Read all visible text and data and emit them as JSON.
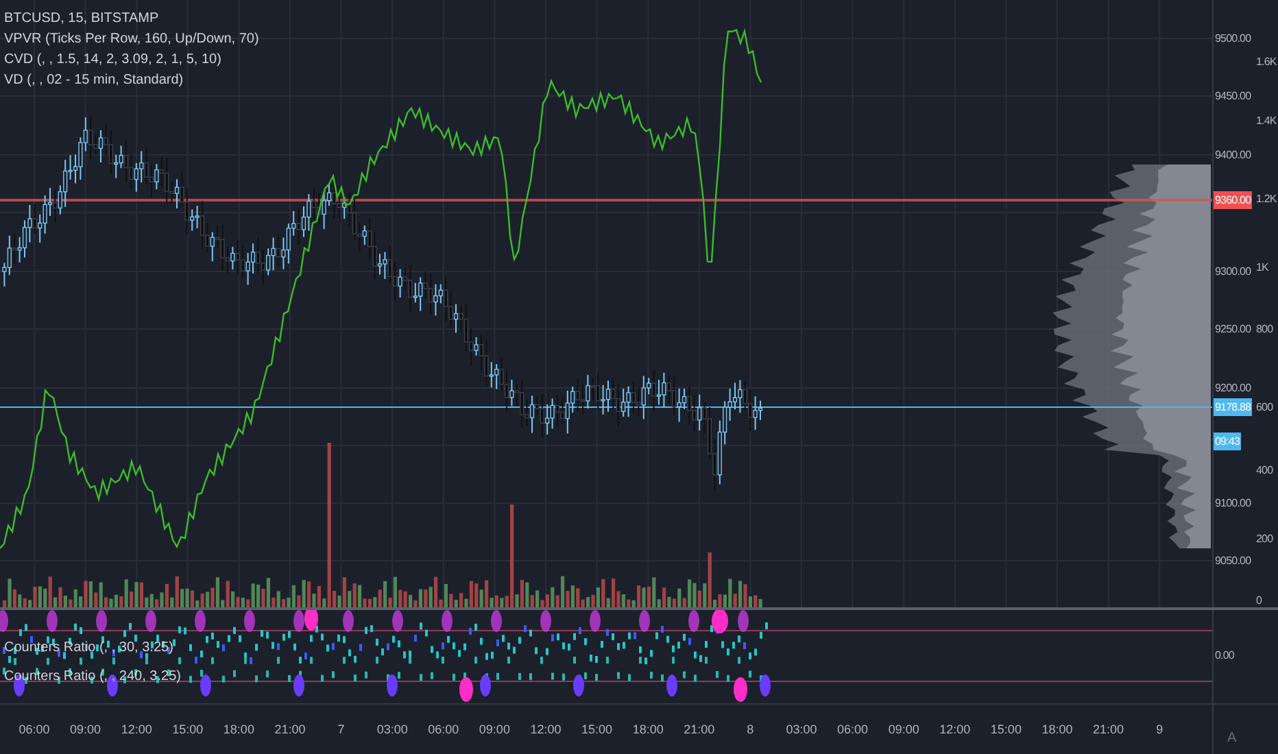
{
  "legend": [
    "BTCUSD, 15, BITSTAMP",
    "VPVR (Ticks Per Row, 160, Up/Down, 70)",
    "CVD (, , 1.5, 14, 2, 3.09, 2, 1, 5, 10)",
    "VD (, , 02 - 15 min, Standard)"
  ],
  "price_axis": [
    {
      "kind": "tick",
      "text": "9500.00"
    },
    {
      "kind": "tick",
      "text": "9450.00"
    },
    {
      "kind": "tick",
      "text": "9400.00"
    },
    {
      "kind": "tag",
      "text": "9360.00",
      "color": "#f05050"
    },
    {
      "kind": "tick",
      "text": "9300.00"
    },
    {
      "kind": "tick",
      "text": "9250.00"
    },
    {
      "kind": "tick",
      "text": "9200.00"
    },
    {
      "kind": "tag",
      "text": "9178.88",
      "color": "#4fb8f0"
    },
    {
      "kind": "tag",
      "text": "09:43",
      "color": "#4fb8f0"
    },
    {
      "kind": "tick",
      "text": "9100.00"
    },
    {
      "kind": "tick",
      "text": "9050.00"
    }
  ],
  "volume_axis": [
    "1.6K",
    "1.4K",
    "1.2K",
    "1K",
    "800",
    "600",
    "400",
    "200",
    "0"
  ],
  "lower_pane": {
    "legend": [
      "Counters Ratio (, , 30, 3.25)",
      "Counters Ratio (, , 240, 3.25)"
    ],
    "axis": [
      "0.00"
    ]
  },
  "time_axis": [
    "06:00",
    "09:00",
    "12:00",
    "15:00",
    "18:00",
    "21:00",
    "7",
    "03:00",
    "06:00",
    "09:00",
    "12:00",
    "15:00",
    "18:00",
    "21:00",
    "8",
    "03:00",
    "06:00",
    "09:00",
    "12:00",
    "15:00",
    "18:00",
    "21:00",
    "9"
  ],
  "scale_buttons": [
    "A"
  ]
}
